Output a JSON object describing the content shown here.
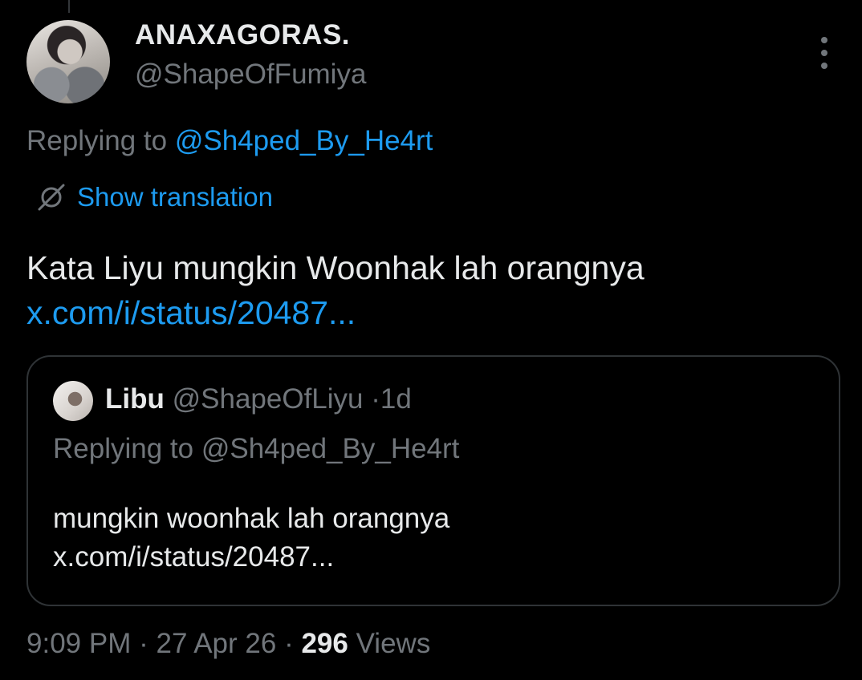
{
  "author": {
    "display_name": "ANAXAGORAS.",
    "handle": "@ShapeOfFumiya"
  },
  "reply_context": {
    "prefix": "Replying to",
    "mention": "@Sh4ped_By_He4rt"
  },
  "translation": {
    "label": "Show translation",
    "icon": "globe-slash-icon"
  },
  "tweet": {
    "text": "Kata Liyu mungkin Woonhak lah orangnya",
    "link": "x.com/i/status/20487..."
  },
  "quote": {
    "display_name": "Libu",
    "handle": "@ShapeOfLiyu",
    "separator": "·",
    "age": "1d",
    "reply_prefix": "Replying to",
    "reply_mention": "@Sh4ped_By_He4rt",
    "text": "mungkin woonhak lah orangnya",
    "link": "x.com/i/status/20487..."
  },
  "footer": {
    "time": "9:09 PM",
    "sep1": "·",
    "date": "27 Apr 26",
    "sep2": "·",
    "views_count": "296",
    "views_label": "Views"
  },
  "colors": {
    "background": "#000000",
    "text": "#e7e9ea",
    "muted": "#71767b",
    "link": "#1d9bf0",
    "border": "#2f3336"
  }
}
